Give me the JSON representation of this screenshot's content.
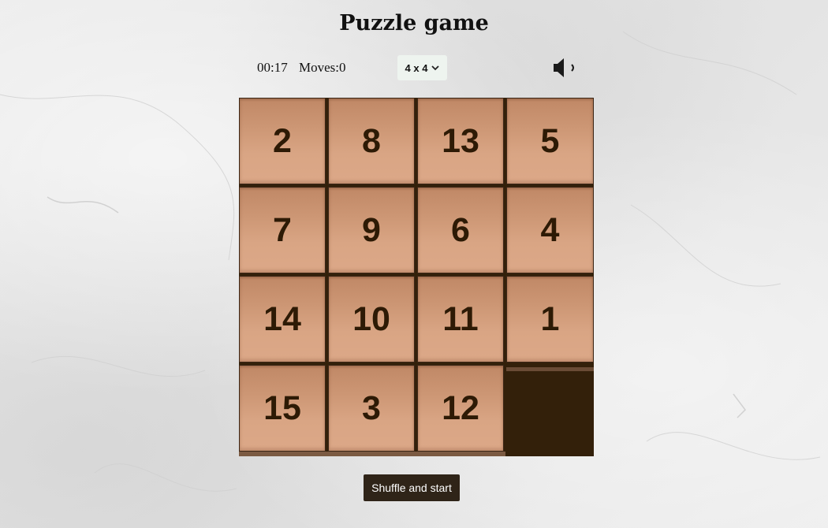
{
  "title": "Puzzle game",
  "status": {
    "timer": "00:17",
    "moves_label": "Moves:0"
  },
  "size_select": {
    "selected": "4 x 4"
  },
  "sound": {
    "icon": "speaker-icon"
  },
  "board": {
    "rows": 4,
    "cols": 4,
    "tiles": [
      [
        "2",
        "8",
        "13",
        "5"
      ],
      [
        "7",
        "9",
        "6",
        "4"
      ],
      [
        "14",
        "10",
        "11",
        "1"
      ],
      [
        "15",
        "3",
        "12",
        ""
      ]
    ],
    "empty_position": "row 4, column 4",
    "colors": {
      "tile": "#d4a07f",
      "tile_text": "#2d1a05",
      "board_background": "#33200a"
    }
  },
  "actions": {
    "shuffle_label": "Shuffle and start"
  }
}
